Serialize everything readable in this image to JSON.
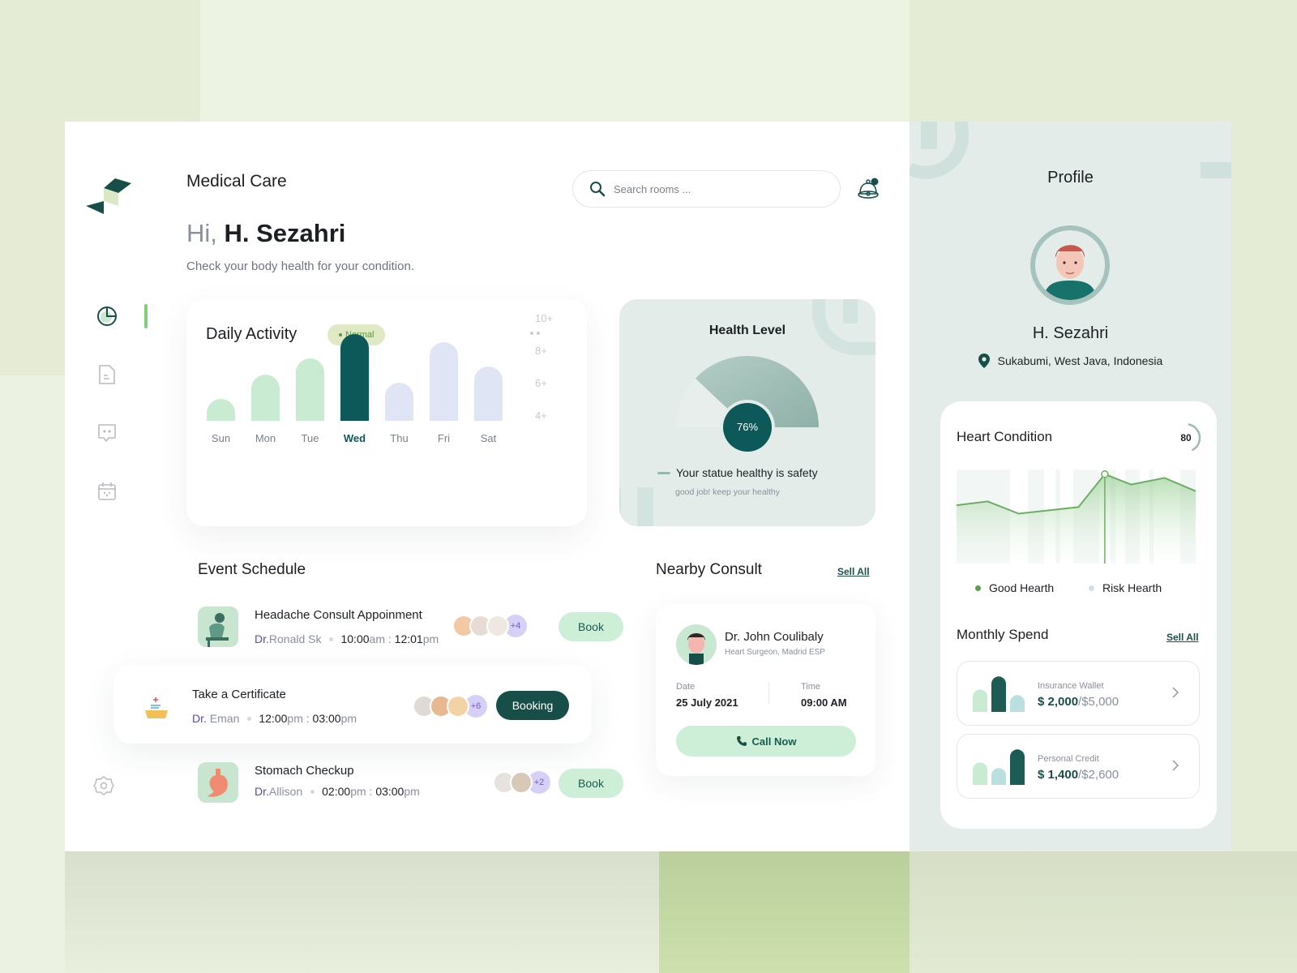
{
  "app": {
    "title": "Medical Care",
    "greeting_prefix": "Hi,",
    "user_name": "H. Sezahri",
    "subtitle": "Check your body health for your condition."
  },
  "search": {
    "placeholder": "Search rooms ..."
  },
  "sidebar": {
    "items": [
      {
        "name": "dashboard",
        "icon": "pie-chart-icon",
        "active": true
      },
      {
        "name": "documents",
        "icon": "document-icon",
        "active": false
      },
      {
        "name": "messages",
        "icon": "chat-icon",
        "active": false
      },
      {
        "name": "calendar",
        "icon": "calendar-icon",
        "active": false
      }
    ],
    "settings_icon": "gear-icon"
  },
  "colors": {
    "primary": "#174f48",
    "accent_green": "#cdeed7",
    "active_bar": "#7ed07a",
    "purple": "#5e4ba5",
    "panel_bg": "#e3ece9"
  },
  "daily_activity": {
    "title": "Daily Activity",
    "badge": "Normal",
    "highlight_day": "Wed"
  },
  "chart_data": [
    {
      "type": "bar",
      "title": "Daily Activity",
      "categories": [
        "Sun",
        "Mon",
        "Tue",
        "Wed",
        "Thu",
        "Fri",
        "Sat"
      ],
      "values": [
        5.5,
        7.0,
        8.0,
        9.5,
        6.5,
        9.0,
        7.5
      ],
      "y_tick_labels": [
        "10+",
        "8+",
        "6+",
        "4+"
      ],
      "ylim": [
        4,
        10
      ],
      "highlight": "Wed",
      "xlabel": "",
      "ylabel": "",
      "grid": false
    },
    {
      "type": "area",
      "title": "Heart Condition",
      "x": [
        0,
        1,
        2,
        3,
        4,
        5,
        6,
        7
      ],
      "values": [
        62,
        66,
        53,
        60,
        95,
        84,
        91,
        77
      ],
      "ylim": [
        0,
        100
      ],
      "highlight_index": 4,
      "legend": [
        "Good Hearth",
        "Risk Hearth"
      ],
      "legend_position": "bottom",
      "grid": false
    }
  ],
  "health_level": {
    "title": "Health Level",
    "percent_label": "76%",
    "value": 0.76,
    "status": "Your statue healthy is safety",
    "hint": "good job! keep your healthy"
  },
  "events": {
    "title": "Event Schedule",
    "items": [
      {
        "name": "Headache Consult Appoinment",
        "dr_prefix": "Dr.",
        "doctor": "Ronald Sk",
        "start": "10:00",
        "start_suffix": "am",
        "end": "12:01",
        "end_suffix": "pm",
        "more": "+4",
        "button": "Book",
        "icon": "headache-illustration-icon"
      },
      {
        "name": "Take a Certificate",
        "dr_prefix": "Dr.",
        "doctor": " Eman",
        "start": "12:00",
        "start_suffix": "pm",
        "end": "03:00",
        "end_suffix": "pm",
        "more": "+6",
        "button": "Booking",
        "icon": "certificate-illustration-icon"
      },
      {
        "name": "Stomach Checkup",
        "dr_prefix": "Dr.",
        "doctor": "Allison",
        "start": "02:00",
        "start_suffix": "pm",
        "end": "03:00",
        "end_suffix": "pm",
        "more": "+2",
        "button": "Book",
        "icon": "stomach-illustration-icon"
      }
    ]
  },
  "nearby": {
    "title": "Nearby Consult",
    "see_all": "Sell All",
    "doctor_name": "Dr. John Coulibaly",
    "doctor_role": "Heart Surgeon, Madrid ESP",
    "date_label": "Date",
    "date": "25 July 2021",
    "time_label": "Time",
    "time": "09:00 AM",
    "call_label": "Call Now"
  },
  "profile": {
    "title": "Profile",
    "name": "H. Sezahri",
    "location": "Sukabumi, West Java, Indonesia"
  },
  "heart": {
    "title": "Heart Condition",
    "score": "80",
    "score_value": 0.8,
    "legend_good": "Good Hearth",
    "legend_risk": "Risk Hearth"
  },
  "spend": {
    "title": "Monthly Spend",
    "see_all": "Sell All",
    "items": [
      {
        "label": "Insurance Wallet",
        "amount": "$ 2,000",
        "total": "/$5,000",
        "bars": [
          0.6,
          0.95,
          0.45
        ]
      },
      {
        "label": "Personal Credit",
        "amount": "$ 1,400",
        "total": "/$2,600",
        "bars": [
          0.6,
          0.45,
          0.95
        ]
      }
    ]
  }
}
